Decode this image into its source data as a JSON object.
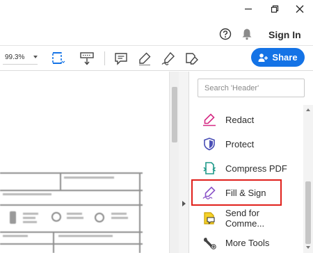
{
  "window": {
    "minimize_icon": "minimize-icon",
    "restore_icon": "restore-icon",
    "close_icon": "close-icon"
  },
  "header": {
    "help_icon": "help-icon",
    "bell_icon": "bell-icon",
    "signin_label": "Sign In"
  },
  "toolbar": {
    "zoom_value": "99.3%",
    "share_label": "Share",
    "accent": "#1473e6"
  },
  "rightpanel": {
    "search_placeholder": "Search 'Header'",
    "tools": [
      {
        "label": "Redact",
        "icon": "redact-icon",
        "color": "#d52a84"
      },
      {
        "label": "Protect",
        "icon": "shield-icon",
        "color": "#4a4fb6"
      },
      {
        "label": "Compress PDF",
        "icon": "compress-pdf-icon",
        "color": "#1f9a8a"
      },
      {
        "label": "Fill & Sign",
        "icon": "fill-sign-icon",
        "color": "#8a53c8"
      },
      {
        "label": "Send for Comme...",
        "icon": "send-for-comment-icon",
        "color": "#e3b400"
      },
      {
        "label": "More Tools",
        "icon": "more-tools-icon",
        "color": "#444444"
      }
    ],
    "highlight_color": "#e0201b"
  }
}
